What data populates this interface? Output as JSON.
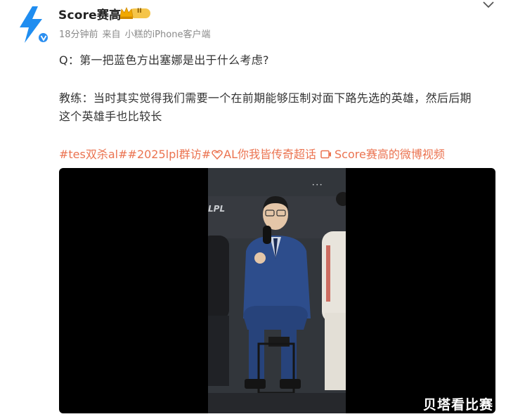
{
  "post": {
    "username": "Score赛高",
    "badge_level": "II",
    "time": "18分钟前",
    "source_prefix": "来自",
    "source_device": "小糕的iPhone客户端",
    "question": "Q：第一把蓝色方出塞娜是出于什么考虑?",
    "answer_line1": "教练：当时其实觉得我们需要一个在前期能够压制对面下路先选的英雄，然后后期",
    "answer_line2": "这个英雄手也比较长",
    "tag1": "#tes双杀al#",
    "tag2": "#2025lpl群访#",
    "tag3": "AL你我皆传奇超话",
    "video_link": "Score赛高的微博视频"
  },
  "video": {
    "frame_logo": "LPL"
  },
  "watermark": "贝塔看比赛",
  "colors": {
    "accent": "#eb7350",
    "verified": "#2a8ef0",
    "crown": "#f5c54a",
    "avatar_bolt": "#1f8df0"
  },
  "icons": [
    "lightning-bolt-avatar",
    "verified-icon",
    "crown-icon",
    "chevron-down-icon",
    "heart-gem-icon",
    "video-icon"
  ]
}
